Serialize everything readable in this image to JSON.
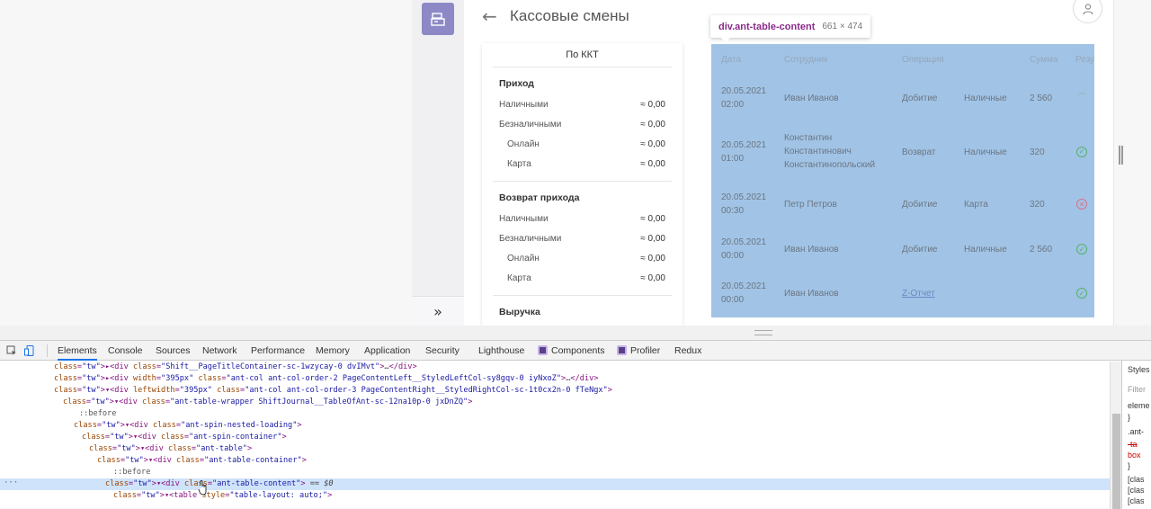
{
  "app": {
    "title": "Кассовые смены",
    "back_icon": "←",
    "collapse_icon": "»"
  },
  "overlay_tooltip": {
    "selector": "div.ant-table-content",
    "size": "661 × 474"
  },
  "kkt_summary": {
    "heading": "По ККТ",
    "sections": [
      {
        "title": "Приход",
        "lines": [
          {
            "label": "Наличными",
            "value": "≈ 0,00",
            "sub": false
          },
          {
            "label": "Безналичными",
            "value": "≈ 0,00",
            "sub": false
          },
          {
            "label": "Онлайн",
            "value": "≈ 0,00",
            "sub": true
          },
          {
            "label": "Карта",
            "value": "≈ 0,00",
            "sub": true
          }
        ]
      },
      {
        "title": "Возврат прихода",
        "lines": [
          {
            "label": "Наличными",
            "value": "≈ 0,00",
            "sub": false
          },
          {
            "label": "Безналичными",
            "value": "≈ 0,00",
            "sub": false
          },
          {
            "label": "Онлайн",
            "value": "≈ 0,00",
            "sub": true
          },
          {
            "label": "Карта",
            "value": "≈ 0,00",
            "sub": true
          }
        ]
      },
      {
        "title": "Выручка",
        "lines": []
      }
    ]
  },
  "journal_table": {
    "headers": {
      "date": "Дата",
      "employee": "Сотрудник",
      "operation": "Операция",
      "amount": "Сумма",
      "result": "Результ"
    },
    "rows": [
      {
        "date": "20.05.2021",
        "time": "02:00",
        "employee": [
          "Иван Иванов"
        ],
        "operation": "Добитие",
        "payment": "Наличные",
        "amount": "2 560",
        "status": "pending"
      },
      {
        "date": "20.05.2021",
        "time": "01:00",
        "employee": [
          "Константин",
          "Константинович",
          "Константинопольский"
        ],
        "operation": "Возврат",
        "payment": "Наличные",
        "amount": "320",
        "status": "ok"
      },
      {
        "date": "20.05.2021",
        "time": "00:30",
        "employee": [
          "Петр Петров"
        ],
        "operation": "Добитие",
        "payment": "Карта",
        "amount": "320",
        "status": "error"
      },
      {
        "date": "20.05.2021",
        "time": "00:00",
        "employee": [
          "Иван Иванов"
        ],
        "operation": "Добитие",
        "payment": "Наличные",
        "amount": "2 560",
        "status": "ok"
      },
      {
        "date": "20.05.2021",
        "time": "00:00",
        "employee": [
          "Иван Иванов"
        ],
        "operation": "Z-Отчет",
        "payment": "",
        "amount": "",
        "status": "ok",
        "operation_link": true
      }
    ]
  },
  "devtools": {
    "tabs": [
      "Elements",
      "Console",
      "Sources",
      "Network",
      "Performance",
      "Memory",
      "Application",
      "Security",
      "Lighthouse",
      "Components",
      "Profiler",
      "Redux"
    ],
    "active_tab": "Elements",
    "dom_lines": [
      "▸<div class=\"Shift__PageTitleContainer-sc-1wzycay-0 dvIMvt\">…</div>",
      "▸<div width=\"395px\" class=\"ant-col ant-col-order-2 PageContentLeft__StyledLeftCol-sy8gqv-0 iyNxoZ\">…</div>",
      "▾<div leftwidth=\"395px\" class=\"ant-col ant-col-order-3 PageContentRight__StyledRightCol-sc-1t0cx2n-0 fTeNgx\">",
      "▾<div class=\"ant-table-wrapper ShiftJournal__TableOfAnt-sc-12na10p-0 jxDnZQ\">",
      "::before",
      "▾<div class=\"ant-spin-nested-loading\">",
      "▾<div class=\"ant-spin-container\">",
      "▾<div class=\"ant-table\">",
      "▾<div class=\"ant-table-container\">",
      "::before",
      "▾<div class=\"ant-table-content\"> == $0",
      "▾<table style=\"table-layout: auto;\">"
    ],
    "styles_label": "Styles",
    "styles_filter": "Filter",
    "styles_lines": [
      "eleme",
      "}",
      ".ant-",
      "-ta",
      "box",
      "}",
      "[clas",
      "[clas",
      "[clas"
    ],
    "colors": {
      "tab_accent": "#1a73e8",
      "selected_row": "#cfe3fa",
      "tag": "#881280",
      "attr_name": "#994500",
      "attr_value": "#1a1aa6"
    }
  },
  "colors": {
    "overlay": "#a1c3e5",
    "nav_active": "#8c89c6",
    "status_ok": "#55b36b",
    "status_error": "#d7738d"
  }
}
